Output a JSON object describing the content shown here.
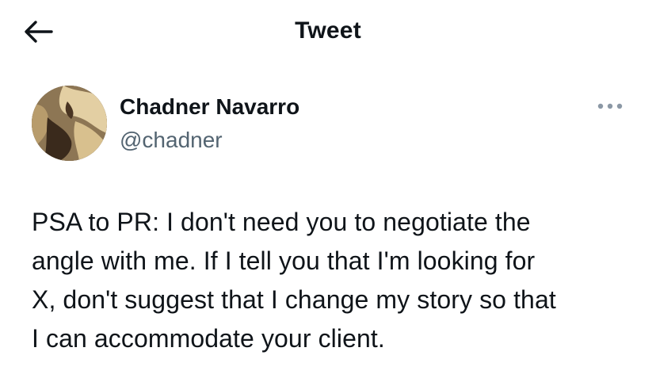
{
  "header": {
    "title": "Tweet",
    "back_icon": "back-arrow-icon"
  },
  "tweet": {
    "author": {
      "display_name": "Chadner Navarro",
      "handle": "@chadner",
      "avatar_colors": [
        "#6b5a3f",
        "#e3cfa3",
        "#3a2a1c"
      ]
    },
    "more_icon": "more-dots-icon",
    "text": "PSA to PR: I don't need you to negotiate the\nangle with me. If I tell you that I'm looking for\nX, don't suggest that I change my story so that\nI can accommodate your client."
  },
  "colors": {
    "text_primary": "#0f1419",
    "text_secondary": "#536471",
    "icon_muted": "#8b98a5",
    "background": "#ffffff"
  }
}
